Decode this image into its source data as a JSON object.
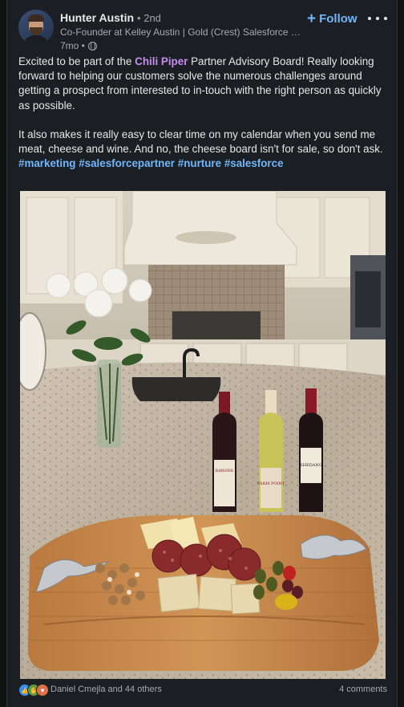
{
  "post": {
    "author": {
      "name": "Hunter Austin",
      "degree": "• 2nd",
      "headline": "Co-Founder at Kelley Austin | Gold (Crest) Salesforce C...",
      "time": "7mo •"
    },
    "follow_label": "Follow",
    "body": {
      "p1_before": "Excited to be part of the ",
      "p1_mention": "Chili Piper",
      "p1_after": " Partner Advisory Board! Really looking forward to helping our customers solve the numerous challenges around getting a prospect from interested to in-touch with the right person as quickly as possible.",
      "p2": "It also makes it really easy to clear time on my calendar when you send me meat, cheese and wine. And no, the cheese board isn't for sale, so don't ask.",
      "hashtags": [
        "#marketing",
        "#salesforcepartner",
        "#nurture",
        "#salesforce"
      ]
    },
    "photo": {
      "wine_labels": [
        "BARONE",
        "FARM POINT",
        "SHEDANG"
      ]
    },
    "social": {
      "reactions": [
        "like-icon",
        "celebrate-icon",
        "love-icon"
      ],
      "reactors_text": "Daniel Cmejla and 44 others",
      "comments_text": "4 comments"
    }
  }
}
